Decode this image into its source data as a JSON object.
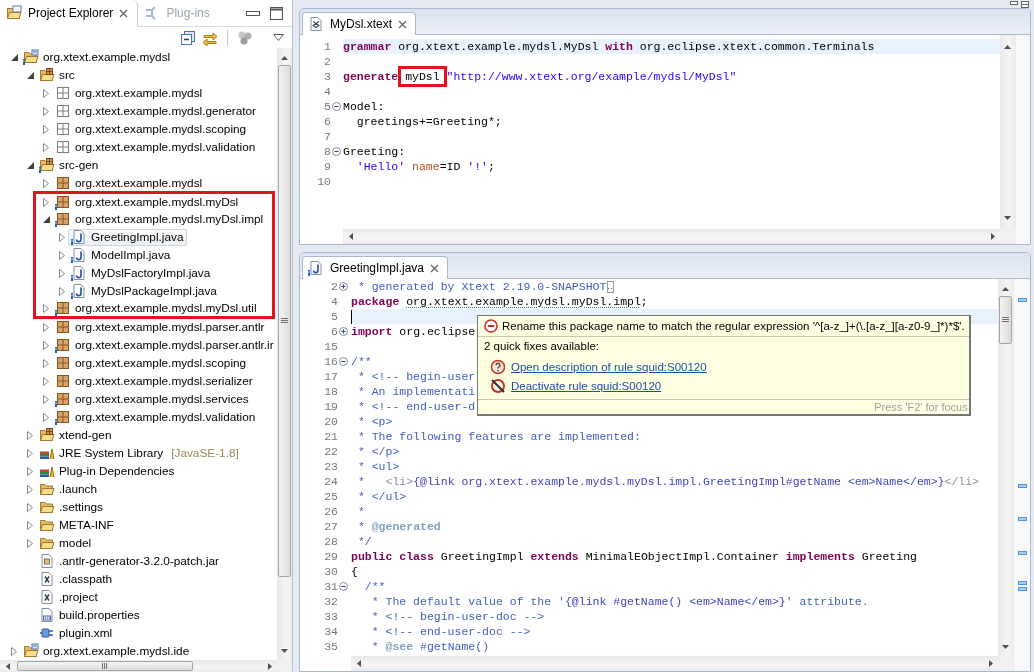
{
  "explorer": {
    "tabs": [
      {
        "label": "Project Explorer",
        "selected": true
      },
      {
        "label": "Plug-ins",
        "selected": false
      }
    ],
    "tree": [
      {
        "label": "org.xtext.example.mydsl",
        "kind": "project",
        "decorated": true,
        "expanded": true,
        "selected": false,
        "highlighted": false,
        "children": [
          {
            "label": "src",
            "kind": "source-folder",
            "decorated": false,
            "expanded": true,
            "selected": false,
            "highlighted": false,
            "children": [
              {
                "label": "org.xtext.example.mydsl",
                "kind": "empty-package",
                "decorated": false,
                "expanded": false,
                "selected": false,
                "highlighted": false
              },
              {
                "label": "org.xtext.example.mydsl.generator",
                "kind": "empty-package",
                "decorated": false,
                "expanded": false,
                "selected": false,
                "highlighted": false
              },
              {
                "label": "org.xtext.example.mydsl.scoping",
                "kind": "empty-package",
                "decorated": false,
                "expanded": false,
                "selected": false,
                "highlighted": false
              },
              {
                "label": "org.xtext.example.mydsl.validation",
                "kind": "empty-package",
                "decorated": false,
                "expanded": false,
                "selected": false,
                "highlighted": false
              }
            ]
          },
          {
            "label": "src-gen",
            "kind": "source-folder",
            "decorated": true,
            "expanded": true,
            "selected": false,
            "highlighted": false,
            "children": [
              {
                "label": "org.xtext.example.mydsl",
                "kind": "package",
                "decorated": false,
                "expanded": false,
                "selected": false,
                "highlighted": false
              },
              {
                "label": "org.xtext.example.mydsl.myDsl",
                "kind": "package",
                "decorated": true,
                "expanded": false,
                "selected": false,
                "highlighted": true
              },
              {
                "label": "org.xtext.example.mydsl.myDsl.impl",
                "kind": "package",
                "decorated": true,
                "expanded": true,
                "selected": false,
                "highlighted": true,
                "children": [
                  {
                    "label": "GreetingImpl.java",
                    "kind": "java-file",
                    "decorated": true,
                    "expanded": false,
                    "selected": true,
                    "highlighted": true
                  },
                  {
                    "label": "ModelImpl.java",
                    "kind": "java-file",
                    "decorated": true,
                    "expanded": false,
                    "selected": false,
                    "highlighted": true
                  },
                  {
                    "label": "MyDslFactoryImpl.java",
                    "kind": "java-file",
                    "decorated": true,
                    "expanded": false,
                    "selected": false,
                    "highlighted": true
                  },
                  {
                    "label": "MyDslPackageImpl.java",
                    "kind": "java-file",
                    "decorated": true,
                    "expanded": false,
                    "selected": false,
                    "highlighted": true
                  }
                ]
              },
              {
                "label": "org.xtext.example.mydsl.myDsl.util",
                "kind": "package",
                "decorated": true,
                "expanded": false,
                "selected": false,
                "highlighted": true
              },
              {
                "label": "org.xtext.example.mydsl.parser.antlr",
                "kind": "package",
                "decorated": false,
                "expanded": false,
                "selected": false,
                "highlighted": false
              },
              {
                "label": "org.xtext.example.mydsl.parser.antlr.ir",
                "kind": "package",
                "decorated": true,
                "expanded": false,
                "selected": false,
                "highlighted": false
              },
              {
                "label": "org.xtext.example.mydsl.scoping",
                "kind": "package",
                "decorated": false,
                "expanded": false,
                "selected": false,
                "highlighted": false
              },
              {
                "label": "org.xtext.example.mydsl.serializer",
                "kind": "package",
                "decorated": false,
                "expanded": false,
                "selected": false,
                "highlighted": false
              },
              {
                "label": "org.xtext.example.mydsl.services",
                "kind": "package",
                "decorated": true,
                "expanded": false,
                "selected": false,
                "highlighted": false
              },
              {
                "label": "org.xtext.example.mydsl.validation",
                "kind": "package",
                "decorated": true,
                "expanded": false,
                "selected": false,
                "highlighted": false
              }
            ]
          },
          {
            "label": "xtend-gen",
            "kind": "source-folder",
            "decorated": false,
            "expanded": false,
            "selected": false,
            "highlighted": false
          },
          {
            "label": "JRE System Library",
            "suffix": "[JavaSE-1.8]",
            "kind": "library",
            "decorated": false,
            "expanded": false,
            "selected": false,
            "highlighted": false
          },
          {
            "label": "Plug-in Dependencies",
            "kind": "library",
            "decorated": false,
            "expanded": false,
            "selected": false,
            "highlighted": false
          },
          {
            "label": ".launch",
            "kind": "folder",
            "decorated": false,
            "expanded": false,
            "selected": false,
            "highlighted": false
          },
          {
            "label": ".settings",
            "kind": "folder",
            "decorated": false,
            "expanded": false,
            "selected": false,
            "highlighted": false
          },
          {
            "label": "META-INF",
            "kind": "folder",
            "decorated": false,
            "expanded": false,
            "selected": false,
            "highlighted": false
          },
          {
            "label": "model",
            "kind": "folder",
            "decorated": false,
            "expanded": false,
            "selected": false,
            "highlighted": false
          },
          {
            "label": ".antlr-generator-3.2.0-patch.jar",
            "kind": "archive",
            "decorated": false,
            "selected": false,
            "highlighted": false
          },
          {
            "label": ".classpath",
            "kind": "xml-file",
            "decorated": false,
            "selected": false,
            "highlighted": false
          },
          {
            "label": ".project",
            "kind": "xml-file",
            "decorated": false,
            "selected": false,
            "highlighted": false
          },
          {
            "label": "build.properties",
            "kind": "properties-file",
            "decorated": false,
            "selected": false,
            "highlighted": false
          },
          {
            "label": "plugin.xml",
            "kind": "plugin-file",
            "decorated": false,
            "selected": false,
            "highlighted": false
          }
        ]
      },
      {
        "label": "org.xtext.example.mydsl.ide",
        "kind": "project",
        "decorated": false,
        "expanded": false,
        "selected": false,
        "highlighted": false
      }
    ]
  },
  "editors": [
    {
      "tab": {
        "label": "MyDsl.xtext",
        "kind": "xtext-file"
      },
      "focused": false,
      "lines": [
        {
          "number": "1",
          "current": true,
          "tokens": [
            {
              "kind": "keyword",
              "text": "grammar"
            },
            {
              "kind": "plain",
              "text": " org.xtext.example.mydsl.MyDsl "
            },
            {
              "kind": "keyword",
              "text": "with"
            },
            {
              "kind": "plain",
              "text": " org.eclipse.xtext.common.Terminals"
            }
          ]
        },
        {
          "number": "2",
          "current": false
        },
        {
          "number": "3",
          "current": false,
          "tokens": [
            {
              "kind": "keyword",
              "text": "generate "
            },
            {
              "kind": "marked",
              "text": "myDsl"
            },
            {
              "kind": "string",
              "text": " \"http://www.xtext.org/example/mydsl/MyDsl\""
            }
          ]
        },
        {
          "number": "4",
          "current": false
        },
        {
          "number": "5",
          "collapsed": false,
          "current": false,
          "tokens": [
            {
              "kind": "plain",
              "text": "Model:"
            }
          ]
        },
        {
          "number": "6",
          "current": false,
          "tokens": [
            {
              "kind": "plain",
              "text": "  greetings+=Greeting*;"
            }
          ]
        },
        {
          "number": "7",
          "current": false
        },
        {
          "number": "8",
          "collapsed": false,
          "current": false,
          "tokens": [
            {
              "kind": "plain",
              "text": "Greeting:"
            }
          ]
        },
        {
          "number": "9",
          "current": false,
          "tokens": [
            {
              "kind": "string",
              "text": "  'Hello' "
            },
            {
              "kind": "field",
              "text": "name"
            },
            {
              "kind": "plain",
              "text": "=ID "
            },
            {
              "kind": "string",
              "text": "'!'"
            },
            {
              "kind": "plain",
              "text": ";"
            }
          ]
        },
        {
          "number": "10",
          "current": false
        }
      ]
    },
    {
      "tab": {
        "label": "GreetingImpl.java",
        "kind": "java-file"
      },
      "focused": true,
      "lines": [
        {
          "number": "2",
          "collapsed": true,
          "current": false,
          "tokens": [
            {
              "kind": "comment",
              "text": " * generated by Xtext 2.19.0-SNAPSHOT"
            },
            {
              "kind": "fold-marker"
            }
          ]
        },
        {
          "number": "4",
          "current": false,
          "tokens": [
            {
              "kind": "keyword",
              "text": "package "
            },
            {
              "kind": "issue",
              "text": "org.xtext.example.mydsl.myDsl.impl"
            },
            {
              "kind": "plain",
              "text": ";"
            }
          ]
        },
        {
          "number": "5",
          "current": true
        },
        {
          "number": "6",
          "collapsed": true,
          "current": false,
          "tokens": [
            {
              "kind": "keyword",
              "text": "import"
            },
            {
              "kind": "plain",
              "text": " org.eclipse"
            }
          ]
        },
        {
          "number": "15",
          "current": false
        },
        {
          "number": "16",
          "collapsed": false,
          "current": false,
          "tokens": [
            {
              "kind": "comment",
              "text": "/**"
            }
          ]
        },
        {
          "number": "17",
          "current": false,
          "tokens": [
            {
              "kind": "comment",
              "text": " * <!-- begin-user"
            }
          ]
        },
        {
          "number": "18",
          "current": false,
          "tokens": [
            {
              "kind": "comment",
              "text": " * An implementati"
            }
          ]
        },
        {
          "number": "19",
          "current": false,
          "tokens": [
            {
              "kind": "comment",
              "text": " * <!-- end-user-d"
            }
          ]
        },
        {
          "number": "20",
          "current": false,
          "tokens": [
            {
              "kind": "comment",
              "text": " * <p>"
            }
          ]
        },
        {
          "number": "21",
          "current": false,
          "tokens": [
            {
              "kind": "comment",
              "text": " * The following features are implemented:"
            }
          ]
        },
        {
          "number": "22",
          "current": false,
          "tokens": [
            {
              "kind": "comment",
              "text": " * </p>"
            }
          ]
        },
        {
          "number": "23",
          "current": false,
          "tokens": [
            {
              "kind": "comment",
              "text": " * <ul>"
            }
          ]
        },
        {
          "number": "24",
          "current": false,
          "tokens": [
            {
              "kind": "comment",
              "text": " *   "
            },
            {
              "kind": "doc-html",
              "text": "<li>"
            },
            {
              "kind": "doc-link",
              "text": "{@link org.xtext.example.mydsl.myDsl.impl.GreetingImpl#getName <em>Name</em>}"
            },
            {
              "kind": "doc-html",
              "text": "</li>"
            }
          ]
        },
        {
          "number": "25",
          "current": false,
          "tokens": [
            {
              "kind": "comment",
              "text": " * </ul>"
            }
          ]
        },
        {
          "number": "26",
          "current": false,
          "tokens": [
            {
              "kind": "comment",
              "text": " *"
            }
          ]
        },
        {
          "number": "27",
          "current": false,
          "tokens": [
            {
              "kind": "comment",
              "text": " * "
            },
            {
              "kind": "doc-tag",
              "text": "@generated"
            }
          ]
        },
        {
          "number": "28",
          "current": false,
          "tokens": [
            {
              "kind": "comment",
              "text": " */"
            }
          ]
        },
        {
          "number": "29",
          "current": false,
          "tokens": [
            {
              "kind": "keyword",
              "text": "public class"
            },
            {
              "kind": "plain",
              "text": " GreetingImpl "
            },
            {
              "kind": "keyword",
              "text": "extends"
            },
            {
              "kind": "plain",
              "text": " MinimalEObjectImpl.Container "
            },
            {
              "kind": "keyword",
              "text": "implements"
            },
            {
              "kind": "plain",
              "text": " Greeting"
            }
          ]
        },
        {
          "number": "30",
          "current": false,
          "tokens": [
            {
              "kind": "plain",
              "text": "{"
            }
          ]
        },
        {
          "number": "31",
          "collapsed": false,
          "current": false,
          "tokens": [
            {
              "kind": "comment",
              "text": "  /**"
            }
          ]
        },
        {
          "number": "32",
          "current": false,
          "tokens": [
            {
              "kind": "comment",
              "text": "   * The default value of the '"
            },
            {
              "kind": "doc-link",
              "text": "{@link #getName() <em>Name</em>}"
            },
            {
              "kind": "comment",
              "text": "' attribute."
            }
          ]
        },
        {
          "number": "33",
          "current": false,
          "tokens": [
            {
              "kind": "comment",
              "text": "   * <!-- begin-user-doc -->"
            }
          ]
        },
        {
          "number": "34",
          "current": false,
          "tokens": [
            {
              "kind": "comment",
              "text": "   * <!-- end-user-doc -->"
            }
          ]
        },
        {
          "number": "35",
          "current": false,
          "tokens": [
            {
              "kind": "comment",
              "text": "   * "
            },
            {
              "kind": "doc-tag",
              "text": "@see"
            },
            {
              "kind": "comment",
              "text": " #getName()"
            }
          ]
        }
      ],
      "hover": {
        "message": "Rename this package name to match the regular expression '^[a-z_]+(\\.[a-z_][a-z0-9_]*)*$'.",
        "heading": "2 quick fixes available:",
        "fixes": [
          {
            "kind": "help",
            "label": "Open description of rule squid:S00120"
          },
          {
            "kind": "deactivate",
            "label": "Deactivate rule squid:S00120"
          }
        ],
        "footer": "Press 'F2' for focus"
      }
    }
  ]
}
